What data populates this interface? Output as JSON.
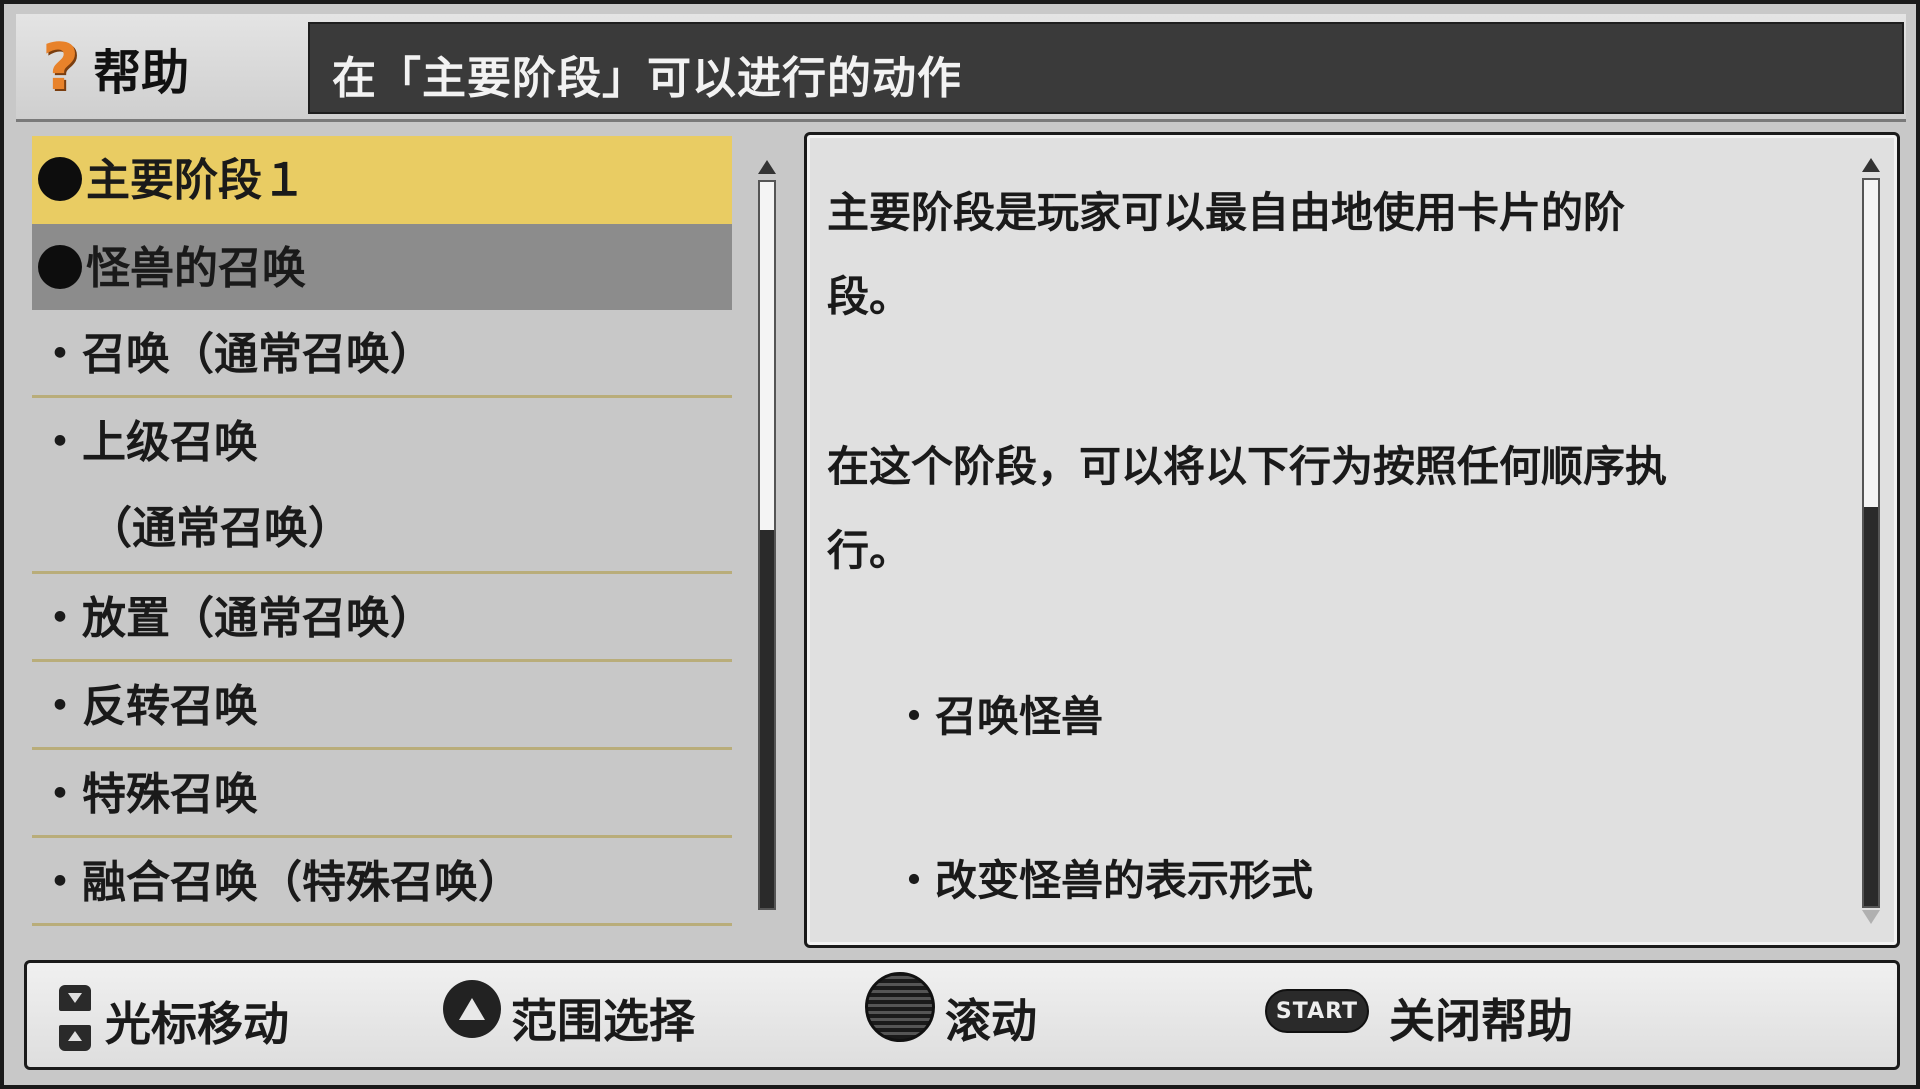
{
  "header": {
    "help_icon": "?",
    "help_label": "帮助",
    "title": "在「主要阶段」可以进行的动作"
  },
  "list": {
    "items": [
      {
        "label": "主要阶段１",
        "state": "selected"
      },
      {
        "label": "怪兽的召唤",
        "state": "section"
      },
      {
        "label": "・召唤（通常召唤）"
      },
      {
        "label": "・上级召唤",
        "label2": "（通常召唤）"
      },
      {
        "label": "・放置（通常召唤）"
      },
      {
        "label": "・反转召唤"
      },
      {
        "label": "・特殊召唤"
      },
      {
        "label": "・融合召唤（特殊召唤）"
      }
    ],
    "scroll_fraction": 0.48
  },
  "description": {
    "lines": [
      "主要阶段是玩家可以最自由地使用卡片的阶",
      "段。",
      "在这个阶段，可以将以下行为按照任何顺序执",
      "行。",
      "・召唤怪兽",
      "・改变怪兽的表示形式"
    ],
    "scroll_fraction": 0.45
  },
  "controls": {
    "move": {
      "icon": "dpad-up-down-icon",
      "label": "光标移动"
    },
    "range": {
      "icon": "triangle-button-icon",
      "label": "范围选择"
    },
    "scroll": {
      "icon": "analog-stick-icon",
      "label": "滚动"
    },
    "close": {
      "icon": "start-button-icon",
      "button_text": "START",
      "label": "关闭帮助"
    }
  },
  "colors": {
    "selected_bg": "#e9cc63",
    "section_bg": "#8c8c8c",
    "help_icon": "#e8822a"
  }
}
